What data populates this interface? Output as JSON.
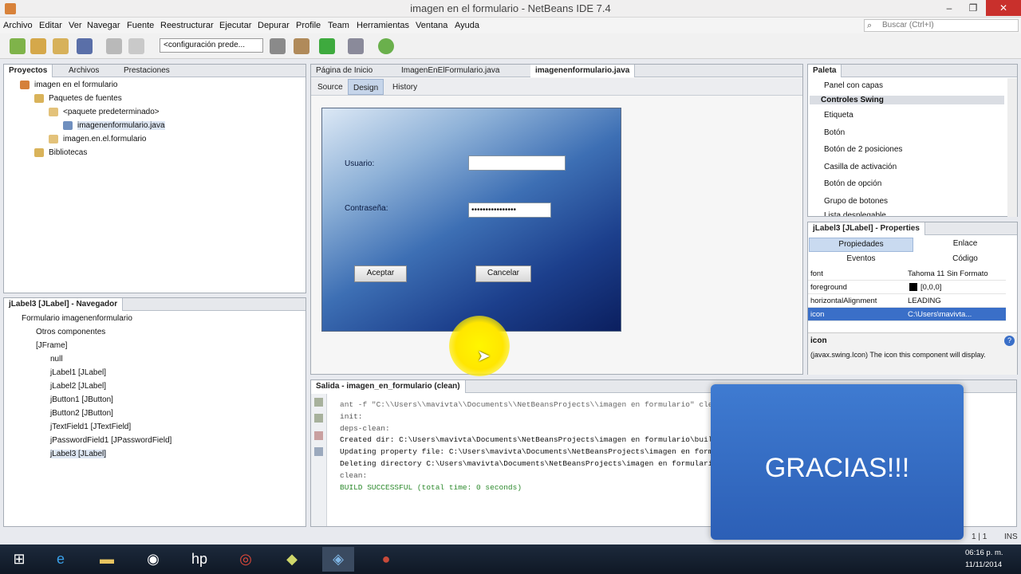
{
  "window": {
    "title": "imagen en el formulario - NetBeans IDE 7.4",
    "minimize": "–",
    "restore": "❐",
    "close": "✕"
  },
  "menu": [
    "Archivo",
    "Editar",
    "Ver",
    "Navegar",
    "Fuente",
    "Reestructurar",
    "Ejecutar",
    "Depurar",
    "Profile",
    "Team",
    "Herramientas",
    "Ventana",
    "Ayuda"
  ],
  "search": {
    "placeholder": "Buscar (Ctrl+I)"
  },
  "toolbar": {
    "config": "<configuración prede..."
  },
  "projects": {
    "tabs": [
      "Proyectos",
      "Archivos",
      "Prestaciones"
    ],
    "tree": [
      "imagen en el formulario",
      "Paquetes de fuentes",
      "<paquete predeterminado>",
      "imagenenformulario.java",
      "imagen.en.el.formulario",
      "Bibliotecas"
    ]
  },
  "navigator": {
    "title": "jLabel3 [JLabel] - Navegador",
    "tree": [
      "Formulario imagenenformulario",
      "Otros componentes",
      "[JFrame]",
      "null",
      "jLabel1 [JLabel]",
      "jLabel2 [JLabel]",
      "jButton1 [JButton]",
      "jButton2 [JButton]",
      "jTextField1 [JTextField]",
      "jPasswordField1 [JPasswordField]",
      "jLabel3 [JLabel]"
    ]
  },
  "editor": {
    "tabs": [
      "Página de Inicio",
      "ImagenEnElFormulario.java",
      "imagenenformulario.java"
    ],
    "modes": [
      "Source",
      "Design",
      "History"
    ]
  },
  "form": {
    "usuario_label": "Usuario:",
    "contrasena_label": "Contraseña:",
    "password_value": "••••••••••••••••",
    "aceptar": "Aceptar",
    "cancelar": "Cancelar"
  },
  "palette": {
    "title": "Paleta",
    "items": [
      "Panel con capas",
      "Controles Swing",
      "Etiqueta",
      "Botón",
      "Botón de 2 posiciones",
      "Casilla de activación",
      "Botón de opción",
      "Grupo de botones",
      "Lista desplegable"
    ]
  },
  "properties": {
    "title": "jLabel3 [JLabel] - Properties",
    "tabs": [
      "Propiedades",
      "Enlace",
      "Eventos",
      "Código"
    ],
    "rows": [
      {
        "key": "font",
        "value": "Tahoma 11 Sin Formato"
      },
      {
        "key": "foreground",
        "value": "[0,0,0]"
      },
      {
        "key": "horizontalAlignment",
        "value": "LEADING"
      },
      {
        "key": "icon",
        "value": "C:\\Users\\mavivta..."
      }
    ],
    "help_title": "icon",
    "help_text": "(javax.swing.Icon) The icon this component will display."
  },
  "output": {
    "title": "Salida - imagen_en_formulario (clean)",
    "lines": [
      "ant -f \"C:\\\\Users\\\\mavivta\\\\Documents\\\\NetBeansProjects\\\\imagen en formulario\" clean",
      "init:",
      "deps-clean:",
      "Created dir: C:\\Users\\mavivta\\Documents\\NetBeansProjects\\imagen en formulario\\build",
      "Updating property file: C:\\Users\\mavivta\\Documents\\NetBeansProjects\\imagen en formulario\\build\\built-clean.properties",
      "Deleting directory C:\\Users\\mavivta\\Documents\\NetBeansProjects\\imagen en formulario\\build",
      "clean:",
      "BUILD SUCCESSFUL (total time: 0 seconds)"
    ]
  },
  "overlay": {
    "text": "GRACIAS!!!"
  },
  "statusbar": {
    "position": "1 | 1",
    "mode": "INS"
  },
  "taskbar": {
    "time": "06:16 p. m.",
    "date": "11/11/2014"
  }
}
